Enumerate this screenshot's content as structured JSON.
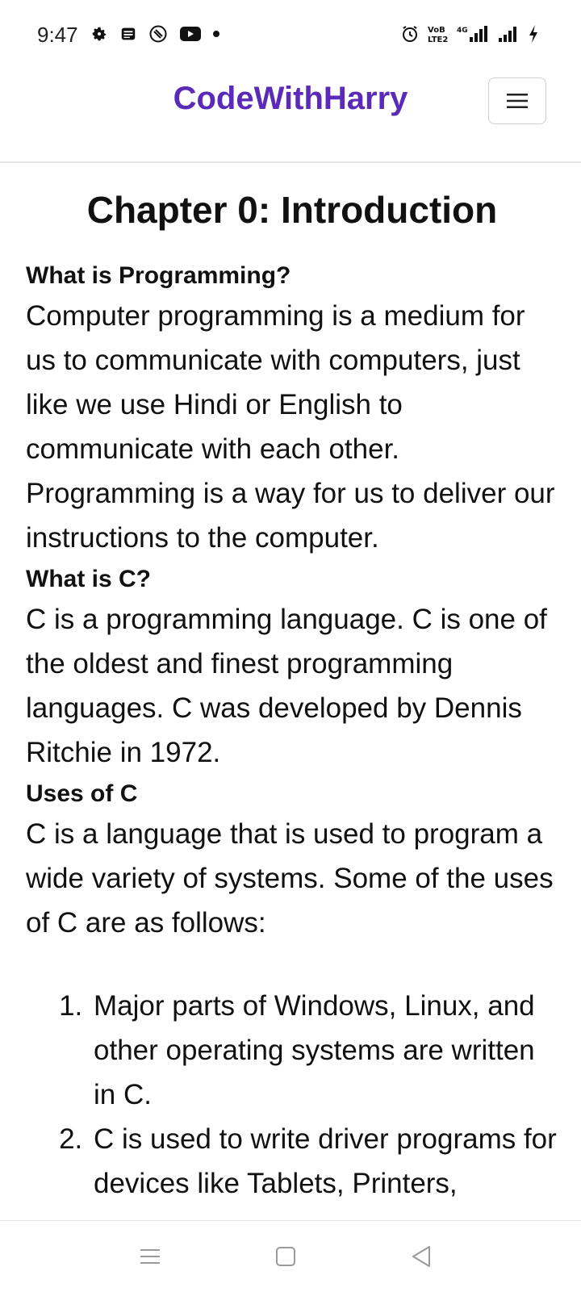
{
  "status_bar": {
    "time": "9:47",
    "left_icons": [
      "gear-icon",
      "news-icon",
      "sync-icon",
      "youtube-icon",
      "dot-icon"
    ],
    "right_icons": [
      "alarm-icon",
      "volte-icon",
      "signal-4g-icon",
      "signal-icon",
      "charging-icon"
    ],
    "volte_label": "VoB LTE2",
    "network_label": "4G"
  },
  "header": {
    "brand": "CodeWithHarry",
    "brand_color": "#5a2bb8",
    "menu_icon": "hamburger-icon"
  },
  "content": {
    "title": "Chapter 0: Introduction",
    "sections": [
      {
        "heading": "What is Programming?",
        "text": "Computer programming is a medium for us to communicate with computers, just like we use Hindi or English to communicate with each other. Programming is a way for us to deliver our instructions to the computer."
      },
      {
        "heading": "What is C?",
        "text": "C is a programming language. C is one of the oldest and finest programming languages. C was developed by Dennis Ritchie in 1972."
      },
      {
        "heading": "Uses of C",
        "text": "C is a language that is used to program a wide variety of systems. Some of the uses of C are as follows:"
      }
    ],
    "uses_list": [
      "Major parts of Windows, Linux, and other operating systems are written in C.",
      "C is used to write driver programs for devices like Tablets, Printers,"
    ]
  },
  "nav_bar": {
    "buttons": [
      "menu-icon",
      "home-square-icon",
      "back-triangle-icon"
    ]
  }
}
